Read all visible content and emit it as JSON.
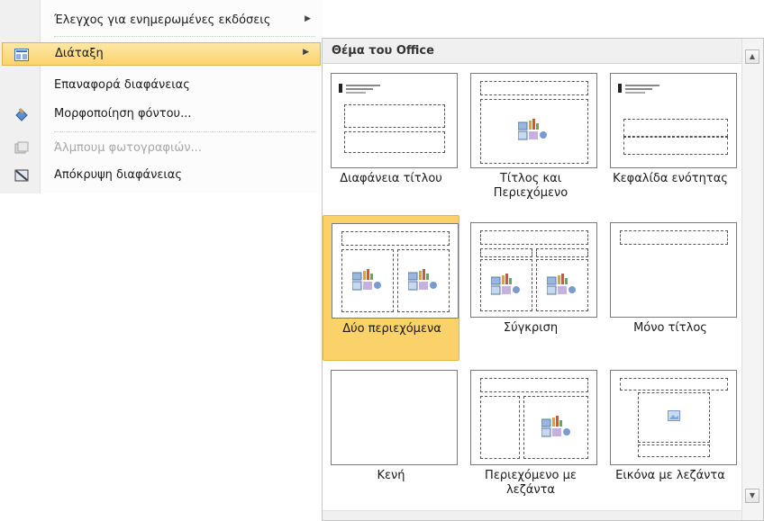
{
  "menu": {
    "items": [
      {
        "label": "Έλεγχος για ενημερωμένες εκδόσεις",
        "icon": "none",
        "has_submenu": true
      },
      {
        "label": "Διάταξη",
        "icon": "layout-icon",
        "has_submenu": true,
        "highlighted": true
      },
      {
        "label": "Επαναφορά διαφάνειας",
        "icon": "none"
      },
      {
        "label": "Μορφοποίηση φόντου...",
        "icon": "format-background-icon"
      },
      {
        "label": "Άλμπουμ φωτογραφιών...",
        "icon": "photo-album-icon",
        "disabled": true
      },
      {
        "label": "Απόκρυψη διαφάνειας",
        "icon": "hide-slide-icon"
      }
    ],
    "submenu_arrow": "▶"
  },
  "gallery": {
    "header": "Θέμα του Office",
    "layouts": [
      {
        "name": "Διαφάνεια τίτλου"
      },
      {
        "name": "Τίτλος και Περιεχόμενο"
      },
      {
        "name": "Κεφαλίδα ενότητας"
      },
      {
        "name": "Δύο περιεχόμενα",
        "selected": true
      },
      {
        "name": "Σύγκριση"
      },
      {
        "name": "Μόνο τίτλος"
      },
      {
        "name": "Κενή"
      },
      {
        "name": "Περιεχόμενο με λεζάντα"
      },
      {
        "name": "Εικόνα με λεζάντα"
      }
    ],
    "scroll_up": "▲",
    "scroll_down": "▼"
  },
  "colors": {
    "highlight": "#fcd36b",
    "selected": "#fbd26a",
    "header_bg": "#f0f0f0"
  }
}
